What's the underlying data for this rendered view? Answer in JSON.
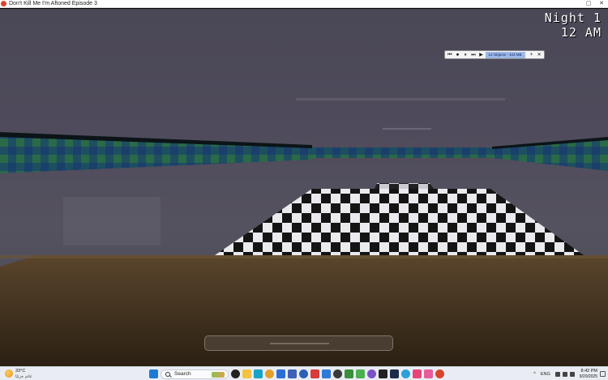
{
  "window": {
    "title": "Don't Kill Me I'm Aftoned Episode 3",
    "controls": {
      "minimize": "–",
      "maximize": "▢",
      "close": "✕"
    }
  },
  "hud": {
    "night_label": "Night 1",
    "time_label": "12 AM"
  },
  "recorder": {
    "buttons": [
      "⏮",
      "⏹",
      "⏸",
      "⏭",
      "▶"
    ],
    "status": "12 Objects - 103 MB",
    "add": "+",
    "close": "✕"
  },
  "taskbar": {
    "weather": {
      "temp": "33°C",
      "desc": "غائم جزئيًا"
    },
    "search_placeholder": "Search",
    "apps": [
      {
        "icon": "start-icon",
        "color": "#1e78d8"
      },
      {
        "icon": "task-view-icon",
        "color": "#222222"
      },
      {
        "icon": "file-explorer-icon",
        "color": "#f3c341"
      },
      {
        "icon": "edge-icon",
        "color": "#1aa3c9"
      },
      {
        "icon": "chrome-icon",
        "color": "#e2a12d"
      },
      {
        "icon": "mail-icon",
        "color": "#2b6fd6"
      },
      {
        "icon": "store-icon",
        "color": "#3f5fb8"
      },
      {
        "icon": "word-icon",
        "color": "#2d5fb4"
      },
      {
        "icon": "red-app-icon",
        "color": "#d83b3b"
      },
      {
        "icon": "blue-app-icon",
        "color": "#2f7ad9"
      },
      {
        "icon": "terminal-icon",
        "color": "#3a3a3a"
      },
      {
        "icon": "game-icon",
        "color": "#3a8f3a"
      },
      {
        "icon": "green-app-icon",
        "color": "#4caf50"
      },
      {
        "icon": "purple-app-icon",
        "color": "#7a52c7"
      },
      {
        "icon": "github-icon",
        "color": "#222222"
      },
      {
        "icon": "clock-app-icon",
        "color": "#1d2b4a"
      },
      {
        "icon": "telegram-icon",
        "color": "#2aa1da"
      },
      {
        "icon": "flower-app-icon",
        "color": "#e6477b"
      },
      {
        "icon": "pink-app-icon",
        "color": "#e85c9a"
      },
      {
        "icon": "game-running-icon",
        "color": "#d9442e"
      }
    ],
    "tray": {
      "caret": "^",
      "lang": "ENG",
      "time": "8:42 PM",
      "date": "9/20/2025"
    }
  },
  "scene": {
    "wall_color": "#4e4b5b",
    "floor_color": "#3f2f1e",
    "stripe_color": "#1f5a64"
  }
}
